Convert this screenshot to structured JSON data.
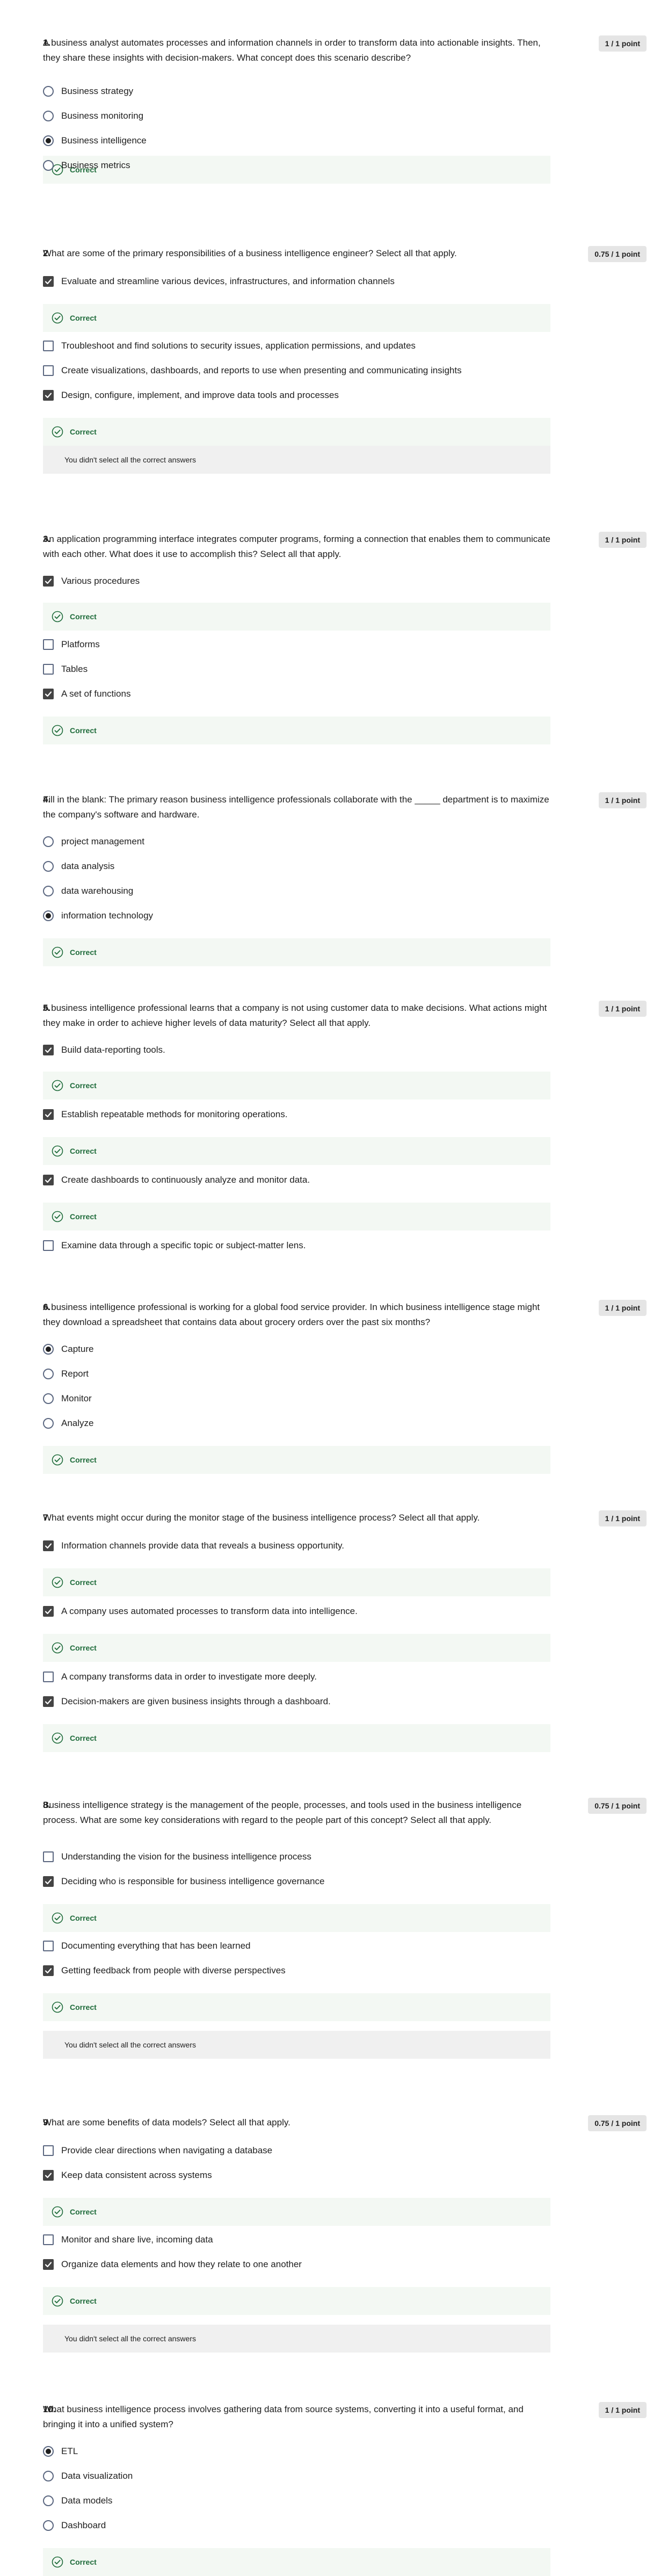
{
  "labels": {
    "correct": "Correct",
    "not_all": "You didn't select all the correct answers"
  },
  "questions": [
    {
      "num": "1.",
      "text": "A business analyst automates processes and information channels in order to transform data into actionable insights. Then, they share these insights with decision-makers. What concept does this scenario describe?",
      "score": "1 / 1 point",
      "options": [
        {
          "label": "Business strategy"
        },
        {
          "label": "Business monitoring"
        },
        {
          "label": "Business intelligence"
        },
        {
          "label": "Business metrics"
        }
      ]
    },
    {
      "num": "2.",
      "text": "What are some of the primary responsibilities of a business intelligence engineer? Select all that apply.",
      "score": "0.75 / 1 point",
      "options": [
        {
          "label": "Evaluate and streamline various devices, infrastructures, and information channels"
        },
        {
          "label": "Troubleshoot and find solutions to security issues, application permissions, and updates"
        },
        {
          "label": "Create visualizations, dashboards, and reports to use when presenting and communicating insights"
        },
        {
          "label": "Design, configure, implement, and improve data tools and processes"
        }
      ]
    },
    {
      "num": "3.",
      "text": "An application programming interface integrates computer programs, forming a connection that enables them to communicate with each other. What does it use to accomplish this? Select all that apply.",
      "score": "1 / 1 point",
      "options": [
        {
          "label": "Various procedures"
        },
        {
          "label": "Platforms"
        },
        {
          "label": "Tables"
        },
        {
          "label": "A set of functions"
        }
      ]
    },
    {
      "num": "4.",
      "text": "Fill in the blank: The primary reason business intelligence professionals collaborate with the _____ department is to maximize the company's software and hardware.",
      "score": "1 / 1 point",
      "options": [
        {
          "label": "project management"
        },
        {
          "label": "data analysis"
        },
        {
          "label": "data warehousing"
        },
        {
          "label": "information technology"
        }
      ]
    },
    {
      "num": "5.",
      "text": "A business intelligence professional learns that a company is not using customer data to make decisions. What actions might they make in order to achieve higher levels of data maturity? Select all that apply.",
      "score": "1 / 1 point",
      "options": [
        {
          "label": "Build data-reporting tools."
        },
        {
          "label": "Establish repeatable methods for monitoring operations."
        },
        {
          "label": "Create dashboards to continuously analyze and monitor data."
        },
        {
          "label": "Examine data through a specific topic or subject-matter lens."
        }
      ]
    },
    {
      "num": "6.",
      "text": "A business intelligence professional is working for a global food service provider. In which business intelligence stage might they download a spreadsheet that contains data about grocery orders over the past six months?",
      "score": "1 / 1 point",
      "options": [
        {
          "label": "Capture"
        },
        {
          "label": "Report"
        },
        {
          "label": "Monitor"
        },
        {
          "label": "Analyze"
        }
      ]
    },
    {
      "num": "7.",
      "text": "What events might occur during the monitor stage of the business intelligence process? Select all that apply.",
      "score": "1 / 1 point",
      "options": [
        {
          "label": "Information channels provide data that reveals a business opportunity."
        },
        {
          "label": "A company uses automated processes to transform data into intelligence."
        },
        {
          "label": "A company transforms data in order to investigate more deeply."
        },
        {
          "label": "Decision-makers are given business insights through a dashboard."
        }
      ]
    },
    {
      "num": "8.",
      "text": "Business intelligence strategy is the management of the people, processes, and tools used in the business intelligence process. What are some key considerations with regard to the people part of this concept? Select all that apply.",
      "score": "0.75 / 1 point",
      "options": [
        {
          "label": "Understanding the vision for the business intelligence process"
        },
        {
          "label": "Deciding who is responsible for business intelligence governance"
        },
        {
          "label": "Documenting everything that has been learned"
        },
        {
          "label": "Getting feedback from people with diverse perspectives"
        }
      ]
    },
    {
      "num": "9.",
      "text": "What are some benefits of data models? Select all that apply.",
      "score": "0.75 / 1 point",
      "options": [
        {
          "label": "Provide clear directions when navigating a database"
        },
        {
          "label": "Keep data consistent across systems"
        },
        {
          "label": "Monitor and share live, incoming data"
        },
        {
          "label": "Organize data elements and how they relate to one another"
        }
      ]
    },
    {
      "num": "10.",
      "text": "What business intelligence process involves gathering data from source systems, converting it into a useful format, and bringing it into a unified system?",
      "score": "1 / 1 point",
      "options": [
        {
          "label": "ETL"
        },
        {
          "label": "Data visualization"
        },
        {
          "label": "Data models"
        },
        {
          "label": "Dashboard"
        }
      ]
    }
  ]
}
